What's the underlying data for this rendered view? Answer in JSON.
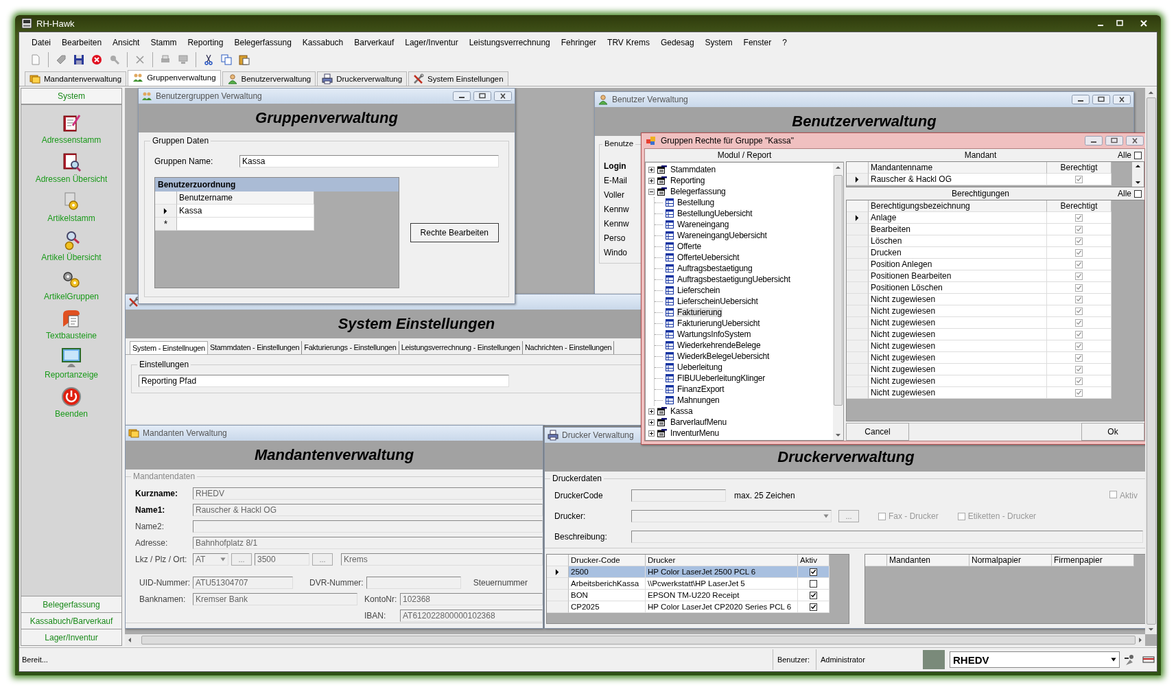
{
  "window": {
    "title": "RH-Hawk"
  },
  "menu": [
    "Datei",
    "Bearbeiten",
    "Ansicht",
    "Stamm",
    "Reporting",
    "Belegerfassung",
    "Kassabuch",
    "Barverkauf",
    "Lager/Inventur",
    "Leistungsverrechnung",
    "Fehringer",
    "TRV Krems",
    "Gedesag",
    "System",
    "Fenster",
    "?"
  ],
  "doc_tabs": [
    {
      "label": "Mandantenverwaltung",
      "kind": "mandant",
      "selected": false
    },
    {
      "label": "Gruppenverwaltung",
      "kind": "group",
      "selected": true
    },
    {
      "label": "Benutzerverwaltung",
      "kind": "user",
      "selected": false
    },
    {
      "label": "Druckerverwaltung",
      "kind": "printer",
      "selected": false
    },
    {
      "label": "System Einstellungen",
      "kind": "settings",
      "selected": false
    }
  ],
  "sidebar": {
    "title": "System",
    "items": [
      {
        "label": "Adressenstamm",
        "kind": "address"
      },
      {
        "label": "Adressen Übersicht",
        "kind": "address-search"
      },
      {
        "label": "Artikelstamm",
        "kind": "article"
      },
      {
        "label": "Artikel Übersicht",
        "kind": "article-search"
      },
      {
        "label": "ArtikelGruppen",
        "kind": "article-group"
      },
      {
        "label": "Textbausteine",
        "kind": "text"
      },
      {
        "label": "Reportanzeige",
        "kind": "report"
      },
      {
        "label": "Beenden",
        "kind": "exit"
      }
    ],
    "groups": [
      "Belegerfassung",
      "Kassabuch/Barverkauf",
      "Lager/Inventur"
    ]
  },
  "settings_window": {
    "heading": "System Einstellungen",
    "tabs": [
      {
        "label": "System - Einstellnugen",
        "selected": true
      },
      {
        "label": "Stammdaten - Einstellungen",
        "selected": false
      },
      {
        "label": "Fakturierungs - Einstellungen",
        "selected": false
      },
      {
        "label": "Leistungsverrechnung - Einstellungen",
        "selected": false
      },
      {
        "label": "Nachrichten - Einstellungen",
        "selected": false
      }
    ],
    "box_label": "Einstellungen",
    "field_value": "Reporting Pfad"
  },
  "user_window": {
    "title": "Benutzer Verwaltung",
    "heading": "Benutzerverwaltung",
    "box_label": "Benutze",
    "labels": [
      {
        "text": "Login",
        "bold": true
      },
      {
        "text": "E-Mail",
        "bold": false
      },
      {
        "text": "Voller",
        "bold": false
      },
      {
        "text": "Kennw",
        "bold": false
      },
      {
        "text": "Kennw",
        "bold": false
      },
      {
        "text": "Perso",
        "bold": false
      },
      {
        "text": "Windo",
        "bold": false
      }
    ]
  },
  "group_window": {
    "title": "Benutzergruppen Verwaltung",
    "heading": "Gruppenverwaltung",
    "box_label": "Gruppen Daten",
    "name_label": "Gruppen Name:",
    "name_value": "Kassa",
    "grid_title": "Benutzerzuordnung",
    "grid_column": "Benutzername",
    "rows": [
      {
        "name": "Kassa",
        "current": true
      }
    ],
    "new_row": "*",
    "button": "Rechte Bearbeiten"
  },
  "mandant_window": {
    "title": "Mandanten Verwaltung",
    "heading": "Mandantenverwaltung",
    "box_label": "Mandantendaten",
    "fields": [
      {
        "label": "Kurzname:",
        "value": "RHEDV",
        "bold": true
      },
      {
        "label": "Name1:",
        "value": "Rauscher & Hackl OG",
        "bold": true
      },
      {
        "label": "Name2:",
        "bold": false
      },
      {
        "label": "Adresse:",
        "value": "Bahnhofplatz 8/1",
        "bold": false
      }
    ],
    "location": {
      "label": "Lkz / Plz / Ort:",
      "country": "AT",
      "zip": "3500",
      "city": "Krems",
      "browse": "..."
    },
    "uid": {
      "label": "UID-Nummer:",
      "value": "ATU51304707"
    },
    "dvr": {
      "label": "DVR-Nummer:"
    },
    "tax": {
      "label": "Steuernummer"
    },
    "bank": {
      "label": "Banknamen:",
      "value": "Kremser Bank"
    },
    "account": {
      "label": "KontoNr:",
      "value": "102368"
    },
    "iban": {
      "label": "IBAN:",
      "value": "AT612022800000102368"
    }
  },
  "printer_window": {
    "title": "Drucker Verwaltung",
    "heading": "Druckerverwaltung",
    "box_label": "Druckerdaten",
    "code_label": "DruckerCode",
    "code_hint": "max. 25 Zeichen",
    "active": {
      "label": "Aktiv",
      "checked": false
    },
    "printer_label": "Drucker:",
    "browse": "...",
    "fax": {
      "label": "Fax - Drucker",
      "checked": false
    },
    "label_printer": {
      "label": "Etiketten - Drucker",
      "checked": false
    },
    "desc_label": "Beschreibung:",
    "columns": [
      "Drucker-Code",
      "Drucker",
      "Aktiv"
    ],
    "rows": [
      {
        "code": "2500",
        "printer": "HP Color LaserJet 2500 PCL 6",
        "active": true,
        "selected": true
      },
      {
        "code": "ArbeitsberichKassa",
        "printer": "\\\\Pcwerkstatt\\HP LaserJet 5",
        "active": false,
        "selected": false
      },
      {
        "code": "BON",
        "printer": "EPSON TM-U220 Receipt",
        "active": true,
        "selected": false
      },
      {
        "code": "CP2025",
        "printer": "HP Color LaserJet CP2020 Series PCL 6",
        "active": true,
        "selected": false
      }
    ],
    "side_columns": [
      "Mandanten",
      "Normalpapier",
      "Firmenpapier"
    ]
  },
  "rights_dialog": {
    "title": "Gruppen Rechte für Gruppe \"Kassa\"",
    "tree_header": "Modul / Report",
    "tree": [
      {
        "label": "Stammdaten",
        "expanded": false
      },
      {
        "label": "Reporting",
        "expanded": false
      },
      {
        "label": "Belegerfassung",
        "expanded": true,
        "children": [
          {
            "label": "Bestellung",
            "selected": false
          },
          {
            "label": "BestellungUebersicht",
            "selected": false
          },
          {
            "label": "Wareneingang",
            "selected": false
          },
          {
            "label": "WareneingangUebersicht",
            "selected": false
          },
          {
            "label": "Offerte",
            "selected": false
          },
          {
            "label": "OfferteUebersicht",
            "selected": false
          },
          {
            "label": "Auftragsbestaetigung",
            "selected": false
          },
          {
            "label": "AuftragsbestaetigungUebersicht",
            "selected": false
          },
          {
            "label": "Lieferschein",
            "selected": false
          },
          {
            "label": "LieferscheinUebersicht",
            "selected": false
          },
          {
            "label": "Fakturierung",
            "selected": true
          },
          {
            "label": "FakturierungUebersicht",
            "selected": false
          },
          {
            "label": "WartungsInfoSystem",
            "selected": false
          },
          {
            "label": "WiederkehrendeBelege",
            "selected": false
          },
          {
            "label": "WiederkBelegeUebersicht",
            "selected": false
          },
          {
            "label": "Ueberleitung",
            "selected": false
          },
          {
            "label": "FIBUUeberleitungKlinger",
            "selected": false
          },
          {
            "label": "FinanzExport",
            "selected": false
          },
          {
            "label": "Mahnungen",
            "selected": false
          }
        ]
      },
      {
        "label": "Kassa",
        "expanded": false
      },
      {
        "label": "BarverlaufMenu",
        "expanded": false
      },
      {
        "label": "InventurMenu",
        "expanded": false
      }
    ],
    "mandant": {
      "header": "Mandant",
      "all_label": "Alle",
      "all_checked": false,
      "columns": [
        "Mandantenname",
        "Berechtigt"
      ],
      "rows": [
        {
          "name": "Rauscher & Hackl OG",
          "checked": true,
          "current": true
        }
      ]
    },
    "rights": {
      "header": "Berechtigungen",
      "all_label": "Alle",
      "all_checked": false,
      "columns": [
        "Berechtigungsbezeichnung",
        "Berechtigt"
      ],
      "rows": [
        {
          "name": "Anlage",
          "checked": true,
          "current": true
        },
        {
          "name": "Bearbeiten",
          "checked": true,
          "current": false
        },
        {
          "name": "Löschen",
          "checked": true,
          "current": false
        },
        {
          "name": "Drucken",
          "checked": true,
          "current": false
        },
        {
          "name": "Position Anlegen",
          "checked": true,
          "current": false
        },
        {
          "name": "Positionen Bearbeiten",
          "checked": true,
          "current": false
        },
        {
          "name": "Positionen Löschen",
          "checked": true,
          "current": false
        },
        {
          "name": "Nicht zugewiesen",
          "checked": true,
          "current": false
        },
        {
          "name": "Nicht zugewiesen",
          "checked": true,
          "current": false
        },
        {
          "name": "Nicht zugewiesen",
          "checked": true,
          "current": false
        },
        {
          "name": "Nicht zugewiesen",
          "checked": true,
          "current": false
        },
        {
          "name": "Nicht zugewiesen",
          "checked": true,
          "current": false
        },
        {
          "name": "Nicht zugewiesen",
          "checked": true,
          "current": false
        },
        {
          "name": "Nicht zugewiesen",
          "checked": true,
          "current": false
        },
        {
          "name": "Nicht zugewiesen",
          "checked": true,
          "current": false
        },
        {
          "name": "Nicht zugewiesen",
          "checked": true,
          "current": false
        }
      ]
    },
    "cancel": "Cancel",
    "ok": "Ok"
  },
  "status_bar": {
    "message": "Bereit...",
    "user_label": "Benutzer:",
    "user": "Administrator",
    "company": "RHEDV"
  }
}
